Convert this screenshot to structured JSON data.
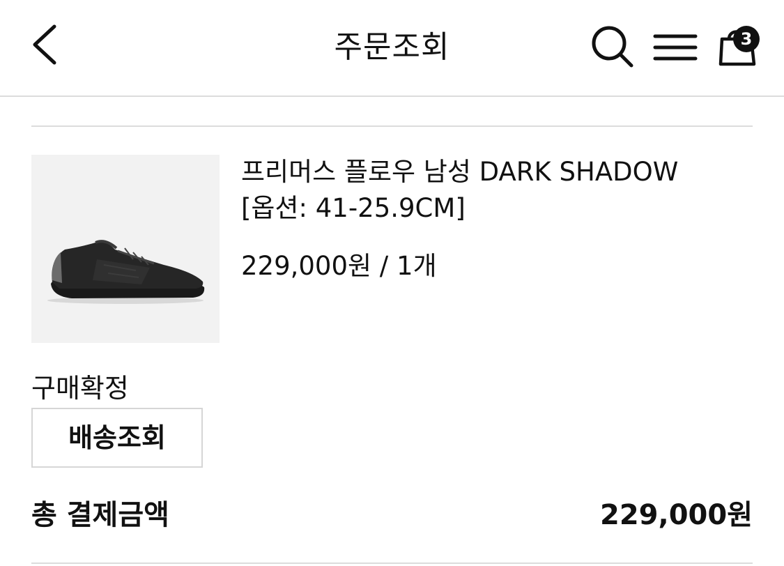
{
  "header": {
    "title": "주문조회",
    "back_icon": "chevron-left-icon",
    "search_icon": "search-icon",
    "menu_icon": "hamburger-menu-icon",
    "cart_icon": "shopping-bag-icon",
    "cart_count": "3"
  },
  "order": {
    "product": {
      "image_icon": "shoe-image",
      "name": "프리머스 플로우 남성 DARK SHADOW",
      "option": "[옵션: 41-25.9CM]",
      "price_qty": "229,000원 / 1개"
    },
    "status": "구매확정",
    "track_button": "배송조회",
    "total_label": "총 결제금액",
    "total_value": "229,000원"
  },
  "colors": {
    "text": "#111111",
    "divider": "#dcdcdc",
    "thumb_bg": "#f2f2f2",
    "badge_bg": "#111111"
  }
}
